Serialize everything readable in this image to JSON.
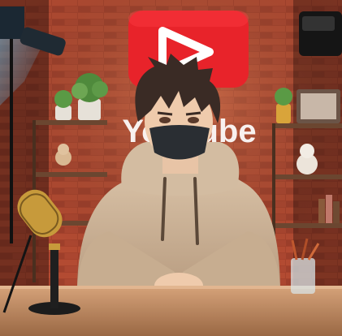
{
  "scene": {
    "wall_logo_text": "YouTube"
  },
  "colors": {
    "brick": "#a5422c",
    "mortar": "#7a3526",
    "logo_red": "#e8232a",
    "hoodie": "#cdb59a",
    "mask": "#2a2e33",
    "hair": "#3a2b25",
    "desk": "#c08d66",
    "mic_gold": "#c79a3b"
  },
  "icons": [
    "youtube-logo-icon",
    "microphone-icon",
    "plant-icon",
    "lamp-icon"
  ]
}
